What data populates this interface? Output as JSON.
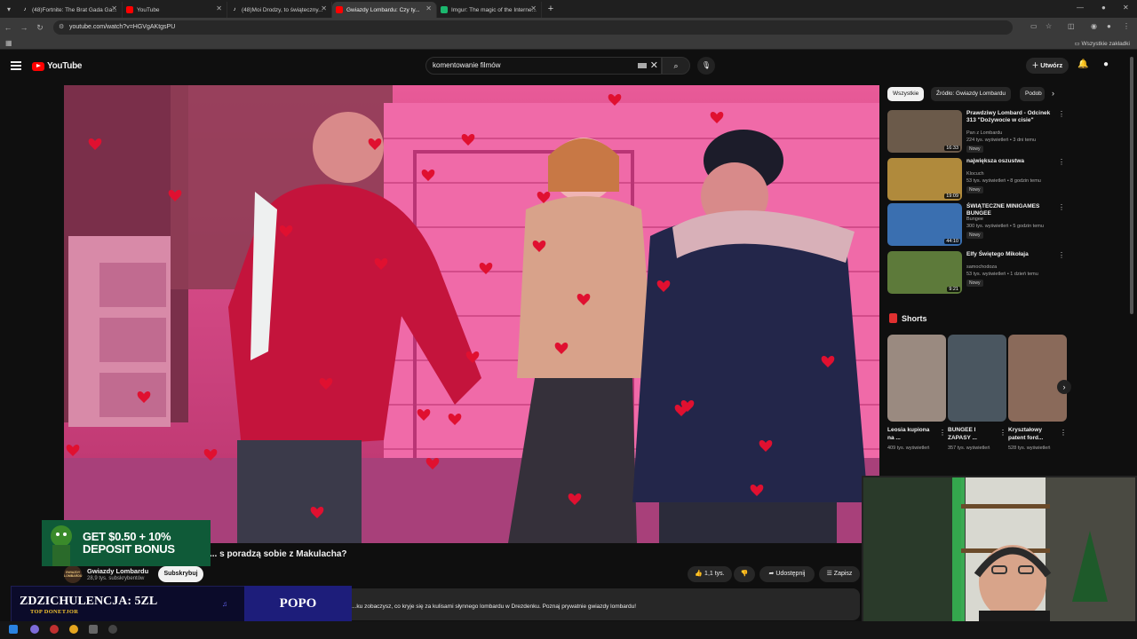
{
  "browser": {
    "tabs": [
      {
        "title": "(48)Fortnite: The Brat Gada Ga...",
        "icon": "tiktok-icon",
        "active": false
      },
      {
        "title": "YouTube",
        "icon": "youtube-icon",
        "active": false
      },
      {
        "title": "(48)Moi Drodzy, to świąteczny...",
        "icon": "tiktok-icon",
        "active": false
      },
      {
        "title": "Gwiazdy Lombardu: Czy ty...",
        "icon": "youtube-icon",
        "active": true
      },
      {
        "title": "Imgur: The magic of the Interne...",
        "icon": "imgur-icon",
        "active": false
      }
    ],
    "new_tab": "+",
    "url": "youtube.com/watch?v=HGVgAKtgsPU",
    "bookmarks_all": "Wszystkie zakładki"
  },
  "youtube": {
    "logo_text": "YouTube",
    "search_value": "komentowanie filmów",
    "create_label": "Utwórz",
    "video": {
      "title": "... s poradzą sobie z Makulacha?",
      "channel_name": "Gwiazdy Lombardu",
      "channel_avatar_text": "GWIAZDY LOMBARDU",
      "subscribers": "28,9 tys. subskrybentów",
      "subscribe_label": "Subskrybuj",
      "likes": "1,1 tys.",
      "share_label": "Udostępnij",
      "save_label": "Zapisz",
      "description": "...ku zobaczysz, co kryje się za kulisami słynnego lombardu w Drezdenku. Poznaj prywatnie gwiazdy lombardu!"
    },
    "chips": [
      "Wszystkie",
      "Źródło: Gwiazdy Lombardu",
      "Podob"
    ],
    "recommendations": [
      {
        "title": "Prawdziwy Lombard - Odcinek 313 \"Dożywocie w cisie\"",
        "channel": "Pan z Lombardu",
        "meta": "224 tys. wyświetleń • 3 dni temu",
        "badge": "Nowy",
        "duration": "16:33",
        "thumb_color": "#6b5a4a"
      },
      {
        "title": "największa oszustwa",
        "channel": "Klocuch",
        "meta": "53 tys. wyświetleń • 8 godzin temu",
        "badge": "Nowy",
        "duration": "19:09",
        "thumb_color": "#b08a3c"
      },
      {
        "title": "ŚWIĄTECZNE MINIGAMES BUNGEE",
        "channel": "Bungee",
        "meta": "300 tys. wyświetleń • 5 godzin temu",
        "badge": "Nowy",
        "duration": "44:10",
        "thumb_color": "#3a6fb0"
      },
      {
        "title": "Elfy Świętego Mikołaja",
        "channel": "samochodoza",
        "meta": "53 tys. wyświetleń • 1 dzień temu",
        "badge": "Nowy",
        "duration": "9:21",
        "thumb_color": "#5d7a3a"
      }
    ],
    "shorts_heading": "Shorts",
    "shorts": [
      {
        "title": "Leosia kupiona na ...",
        "views": "409 tys. wyświetleń",
        "thumb_color": "#9a8a80"
      },
      {
        "title": "BUNGEE I ZAPASY ...",
        "views": "357 tys. wyświetleń",
        "thumb_color": "#4a5660"
      },
      {
        "title": "Kryształowy patent ford...",
        "views": "528 tys. wyświetleń",
        "thumb_color": "#8a6a5a"
      }
    ]
  },
  "overlays": {
    "ad_line1": "GET $0.50 + 10%",
    "ad_line2": "DEPOSIT BONUS",
    "donor_name": "ZDZICHULENCJA: 5ZL",
    "donor_sub": "TOP DONETJOR",
    "donor_right": "POPO"
  },
  "colors": {
    "accent_red": "#ff0000",
    "video_tint": "#d6427f",
    "background": "#0f0f0f"
  }
}
